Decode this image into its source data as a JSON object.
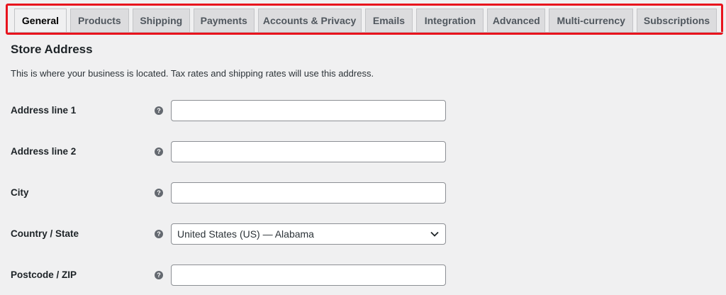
{
  "tabs": [
    {
      "label": "General",
      "active": true
    },
    {
      "label": "Products",
      "active": false
    },
    {
      "label": "Shipping",
      "active": false
    },
    {
      "label": "Payments",
      "active": false
    },
    {
      "label": "Accounts & Privacy",
      "active": false
    },
    {
      "label": "Emails",
      "active": false
    },
    {
      "label": "Integration",
      "active": false
    },
    {
      "label": "Advanced",
      "active": false
    },
    {
      "label": "Multi-currency",
      "active": false
    },
    {
      "label": "Subscriptions",
      "active": false
    }
  ],
  "highlight_color": "#e8131d",
  "section": {
    "title": "Store Address",
    "description": "This is where your business is located. Tax rates and shipping rates will use this address."
  },
  "fields": {
    "address1": {
      "label": "Address line 1",
      "value": "",
      "help_icon": "question-circle-icon"
    },
    "address2": {
      "label": "Address line 2",
      "value": "",
      "help_icon": "question-circle-icon"
    },
    "city": {
      "label": "City",
      "value": "",
      "help_icon": "question-circle-icon"
    },
    "country": {
      "label": "Country / State",
      "value": "United States (US) — Alabama",
      "help_icon": "question-circle-icon"
    },
    "postcode": {
      "label": "Postcode / ZIP",
      "value": "",
      "help_icon": "question-circle-icon"
    }
  },
  "help_glyph": "?"
}
